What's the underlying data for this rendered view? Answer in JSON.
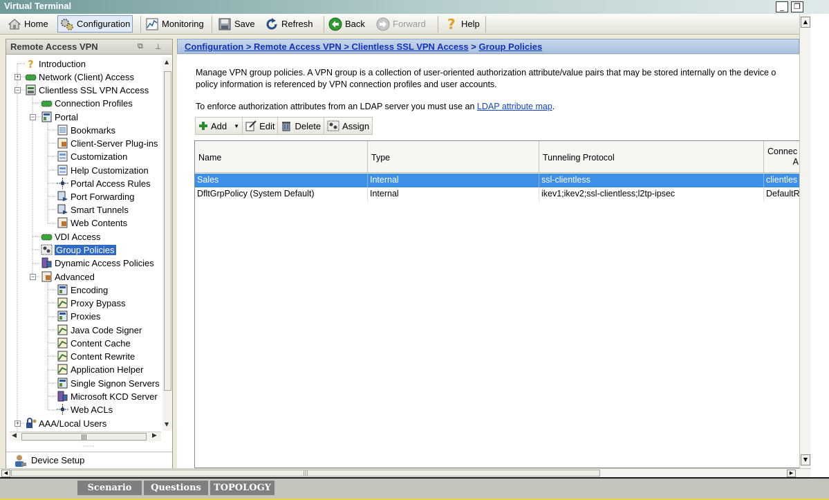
{
  "window": {
    "title": "Virtual Terminal",
    "minimize": "_",
    "restore": "❐"
  },
  "toolbar": {
    "home": "Home",
    "configuration": "Configuration",
    "monitoring": "Monitoring",
    "save": "Save",
    "refresh": "Refresh",
    "back": "Back",
    "forward": "Forward",
    "help": "Help"
  },
  "left_panel": {
    "title": "Remote Access VPN",
    "tree": [
      "Introduction",
      "Network (Client) Access",
      "Clientless SSL VPN Access",
      "Connection Profiles",
      "Portal",
      "Bookmarks",
      "Client-Server Plug-ins",
      "Customization",
      "Help Customization",
      "Portal Access Rules",
      "Port Forwarding",
      "Smart Tunnels",
      "Web Contents",
      "VDI Access",
      "Group Policies",
      "Dynamic Access Policies",
      "Advanced",
      "Encoding",
      "Proxy Bypass",
      "Proxies",
      "Java Code Signer",
      "Content Cache",
      "Content Rewrite",
      "Application Helper",
      "Single Signon Servers",
      "Microsoft KCD Server",
      "Web ACLs",
      "AAA/Local Users"
    ],
    "device_setup": "Device Setup"
  },
  "breadcrumb": {
    "path": "Configuration > Remote Access VPN > Clientless SSL VPN Access",
    "separator": ">",
    "current": "Group Policies"
  },
  "description": {
    "line1": "Manage VPN group policies. A VPN group is a collection of user-oriented authorization attribute/value pairs that may be stored internally on the device o",
    "line2": "policy information is referenced by VPN connection profiles and user accounts.",
    "ldap_prefix": "To enforce authorization attributes from an LDAP server you must use an ",
    "ldap_link": "LDAP attribute map",
    "ldap_suffix": "."
  },
  "actions": {
    "add": "Add",
    "edit": "Edit",
    "delete": "Delete",
    "assign": "Assign"
  },
  "table": {
    "headers": [
      "Name",
      "Type",
      "Tunneling Protocol",
      "Connec"
    ],
    "header_extra": "A",
    "rows": [
      [
        "Sales",
        "Internal",
        "ssl-clientless",
        "clientles"
      ],
      [
        "DfltGrpPolicy (System Default)",
        "Internal",
        "ikev1;ikev2;ssl-clientless;l2tp-ipsec",
        "DefaultR"
      ]
    ]
  },
  "bottom_tabs": {
    "scenario": "Scenario",
    "questions": "Questions",
    "topology": "TOPOLOGY"
  },
  "colors": {
    "selection": "#3d8fe8",
    "tree_selection": "#316ac5",
    "link": "#1133bb"
  }
}
